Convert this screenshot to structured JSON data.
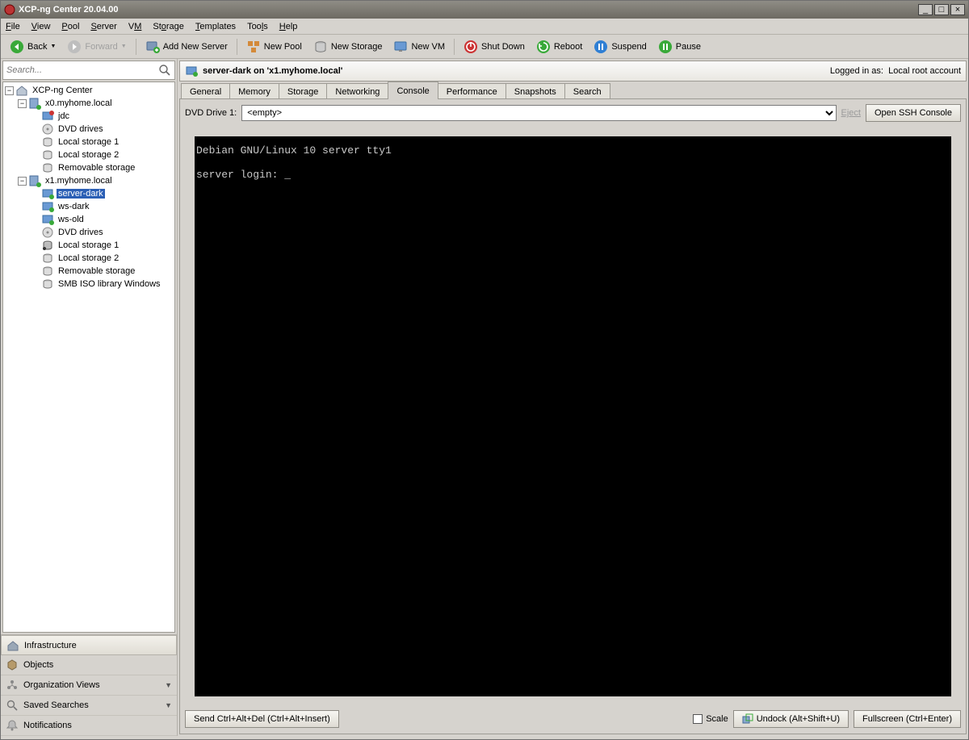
{
  "titlebar": {
    "title": "XCP-ng Center 20.04.00"
  },
  "menu": {
    "file": "File",
    "view": "View",
    "pool": "Pool",
    "server": "Server",
    "vm": "VM",
    "storage": "Storage",
    "templates": "Templates",
    "tools": "Tools",
    "help": "Help"
  },
  "toolbar": {
    "back": "Back",
    "forward": "Forward",
    "add_server": "Add New Server",
    "new_pool": "New Pool",
    "new_storage": "New Storage",
    "new_vm": "New VM",
    "shutdown": "Shut Down",
    "reboot": "Reboot",
    "suspend": "Suspend",
    "pause": "Pause"
  },
  "search": {
    "placeholder": "Search..."
  },
  "tree": {
    "root": "XCP-ng Center",
    "host0": {
      "name": "x0.myhome.local",
      "items": [
        "jdc",
        "DVD drives",
        "Local storage 1",
        "Local storage 2",
        "Removable storage"
      ]
    },
    "host1": {
      "name": "x1.myhome.local",
      "items": [
        "server-dark",
        "ws-dark",
        "ws-old",
        "DVD drives",
        "Local storage 1",
        "Local storage 2",
        "Removable storage",
        "SMB ISO library Windows"
      ]
    }
  },
  "bottom_nav": {
    "infrastructure": "Infrastructure",
    "objects": "Objects",
    "org_views": "Organization Views",
    "saved_searches": "Saved Searches",
    "notifications": "Notifications"
  },
  "content": {
    "header_title": "server-dark on 'x1.myhome.local'",
    "logged_in_prefix": "Logged in as:",
    "logged_in_user": "Local root account",
    "tabs": [
      "General",
      "Memory",
      "Storage",
      "Networking",
      "Console",
      "Performance",
      "Snapshots",
      "Search"
    ],
    "active_tab": "Console",
    "dvd_label": "DVD Drive 1:",
    "dvd_value": "<empty>",
    "eject": "Eject",
    "open_ssh": "Open SSH Console",
    "console_text": "Debian GNU/Linux 10 server tty1\n\nserver login: _",
    "send_cad": "Send Ctrl+Alt+Del (Ctrl+Alt+Insert)",
    "scale": "Scale",
    "undock": "Undock (Alt+Shift+U)",
    "fullscreen": "Fullscreen (Ctrl+Enter)"
  }
}
